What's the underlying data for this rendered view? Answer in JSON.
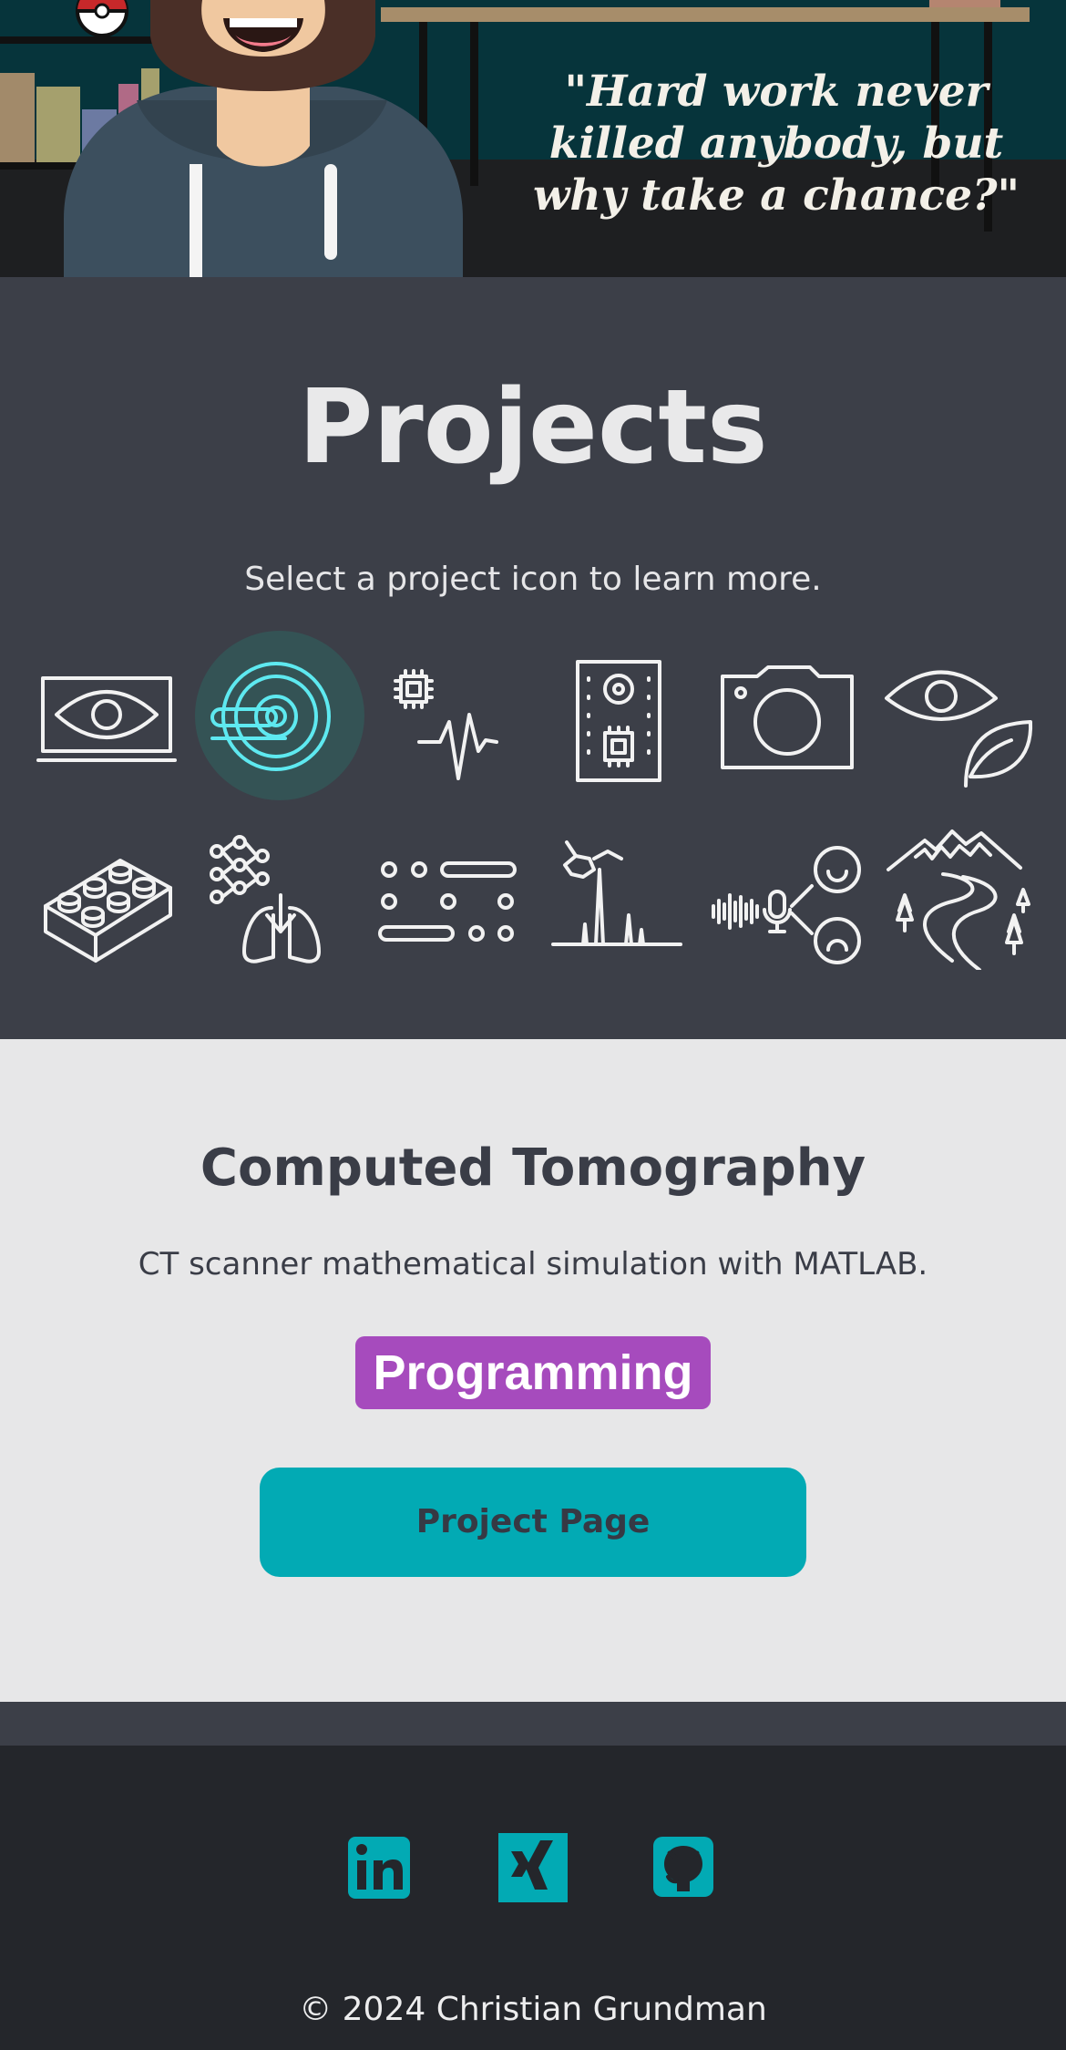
{
  "hero": {
    "quote": "\"Hard work never killed anybody, but why take a chance?\"",
    "avatar_icon": "bearded-man-hoodie-avatar",
    "colors": {
      "wall": "#06343b",
      "floor": "#1e1f21",
      "hoodie": "#3c4f5e",
      "beard": "#4a2f27"
    }
  },
  "projects": {
    "title": "Projects",
    "subtitle": "Select a project icon to learn more.",
    "selected_index": 1,
    "icons": [
      {
        "name": "eye-monitor-icon"
      },
      {
        "name": "ct-scanner-icon"
      },
      {
        "name": "chip-heartbeat-icon"
      },
      {
        "name": "speaker-chip-icon"
      },
      {
        "name": "camera-icon"
      },
      {
        "name": "eye-leaf-icon"
      },
      {
        "name": "lego-brick-icon"
      },
      {
        "name": "neural-network-lungs-icon"
      },
      {
        "name": "morse-dots-dashes-icon"
      },
      {
        "name": "molecule-spectrum-icon"
      },
      {
        "name": "voice-emotion-icon"
      },
      {
        "name": "mountain-road-icon"
      }
    ],
    "colors": {
      "background": "#3c3f48",
      "selected_glow": "#345355",
      "selected_stroke": "#5ee9f0"
    }
  },
  "detail": {
    "title": "Computed Tomography",
    "description": "CT scanner mathematical simulation with MATLAB.",
    "tag": "Programming",
    "button_label": "Project Page",
    "colors": {
      "tag": "#a64bbd",
      "button": "#02aab4"
    }
  },
  "footer": {
    "social": [
      {
        "name": "linkedin-icon"
      },
      {
        "name": "xing-icon"
      },
      {
        "name": "github-icon"
      }
    ],
    "copyright": "© 2024 Christian Grundman",
    "accent": "#02aab4"
  }
}
